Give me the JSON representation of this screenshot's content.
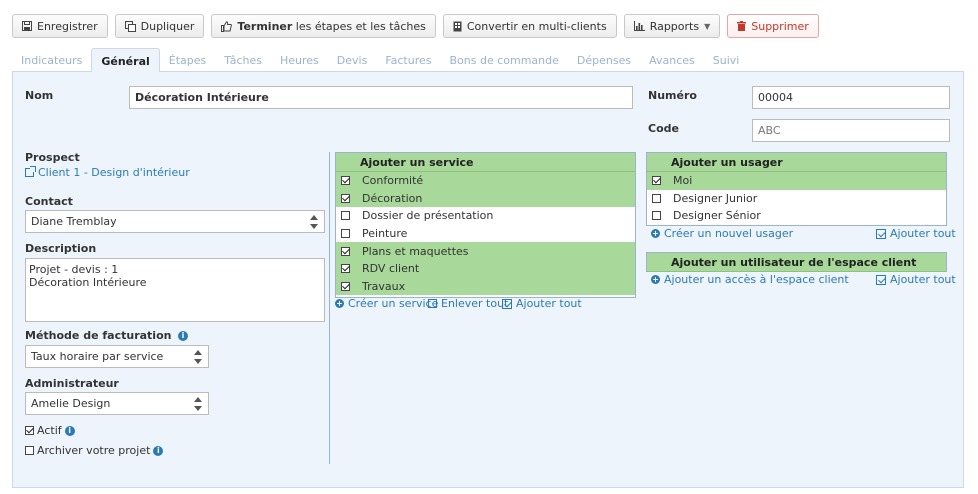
{
  "toolbar": {
    "save": "Enregistrer",
    "duplicate": "Dupliquer",
    "finish_bold": "Terminer",
    "finish_rest": " les étapes et les tâches",
    "convert": "Convertir en multi-clients",
    "reports": "Rapports",
    "delete": "Supprimer"
  },
  "tabs": [
    "Indicateurs",
    "Général",
    "Étapes",
    "Tâches",
    "Heures",
    "Devis",
    "Factures",
    "Bons de commande",
    "Dépenses",
    "Avances",
    "Suivi"
  ],
  "active_tab": "Général",
  "form": {
    "nom_label": "Nom",
    "nom_value": "Décoration Intérieure",
    "numero_label": "Numéro",
    "numero_value": "00004",
    "code_label": "Code",
    "code_placeholder": "ABC",
    "prospect_label": "Prospect",
    "prospect_link": "Client 1 - Design d'intérieur",
    "contact_label": "Contact",
    "contact_value": "Diane Tremblay",
    "description_label": "Description",
    "description_value": "Projet - devis : 1\nDécoration Intérieure",
    "billing_label": "Méthode de facturation",
    "billing_value": "Taux horaire par service",
    "admin_label": "Administrateur",
    "admin_value": "Amelie Design",
    "active_label": "Actif",
    "active_checked": true,
    "archive_label": "Archiver votre projet",
    "archive_checked": false
  },
  "services": {
    "header": "Ajouter un service",
    "items": [
      {
        "label": "Conformité",
        "checked": true
      },
      {
        "label": "Décoration",
        "checked": true
      },
      {
        "label": "Dossier de présentation",
        "checked": false
      },
      {
        "label": "Peinture",
        "checked": false
      },
      {
        "label": "Plans et maquettes",
        "checked": true
      },
      {
        "label": "RDV client",
        "checked": true
      },
      {
        "label": "Travaux",
        "checked": true
      }
    ],
    "create": "Créer un service",
    "remove_all": "Enlever tout",
    "add_all": "Ajouter tout"
  },
  "users": {
    "header": "Ajouter un usager",
    "items": [
      {
        "label": "Moi",
        "checked": true
      },
      {
        "label": "Designer Junior",
        "checked": false
      },
      {
        "label": "Designer Sénior",
        "checked": false
      }
    ],
    "create": "Créer un nouvel usager",
    "add_all": "Ajouter tout"
  },
  "client_space": {
    "header": "Ajouter un utilisateur de l'espace client",
    "add_access": "Ajouter un accès à l'espace client",
    "add_all": "Ajouter tout"
  },
  "colors": {
    "checked_row": "#a8d99a",
    "link": "#2a7ab5",
    "panel_bg": "#eef4fb",
    "delete": "#c0392b"
  }
}
